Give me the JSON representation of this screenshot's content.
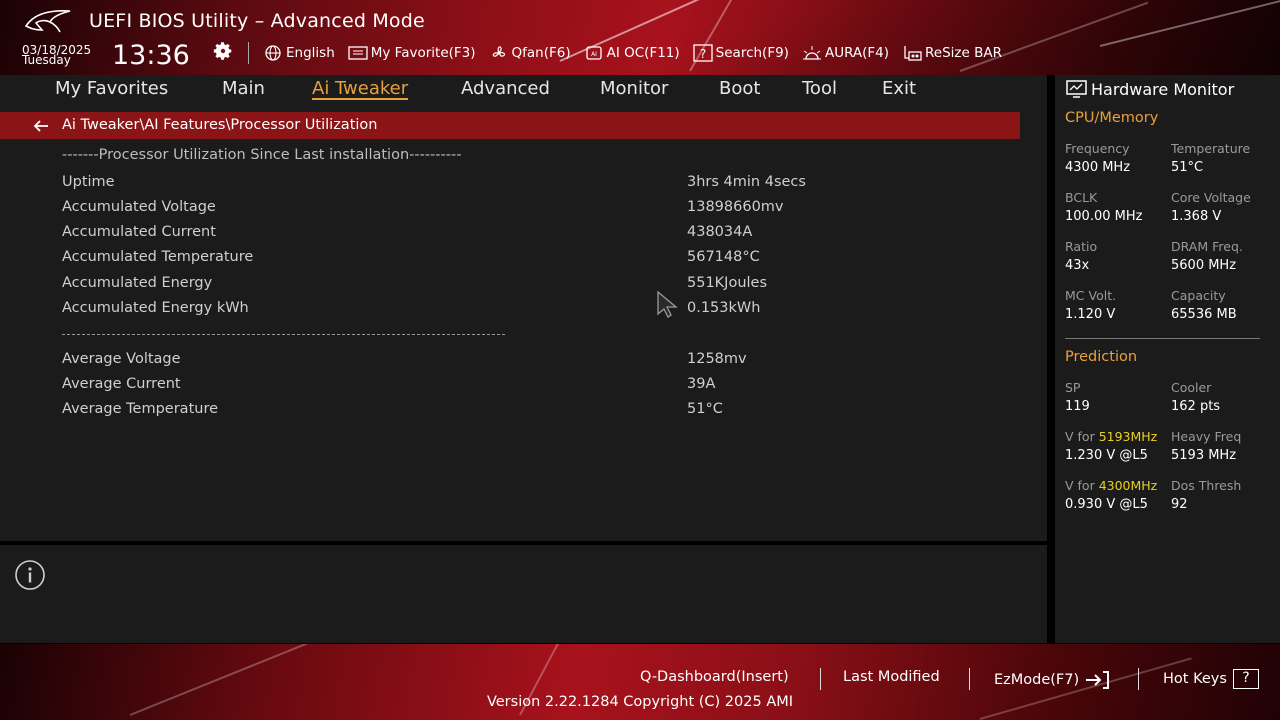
{
  "header": {
    "title": "UEFI BIOS Utility – Advanced Mode",
    "date": "03/18/2025",
    "weekday": "Tuesday",
    "time": "13:36",
    "toolbar": [
      {
        "icon": "globe-icon",
        "label": "English"
      },
      {
        "icon": "my-favorite-icon",
        "label": "My Favorite(F3)"
      },
      {
        "icon": "fan-icon",
        "label": "Qfan(F6)"
      },
      {
        "icon": "ai-oc-icon",
        "label": "AI OC(F11)"
      },
      {
        "icon": "search-icon",
        "label": "Search(F9)"
      },
      {
        "icon": "aura-icon",
        "label": "AURA(F4)"
      },
      {
        "icon": "resize-bar-icon",
        "label": "ReSize BAR"
      }
    ]
  },
  "nav": {
    "tabs": [
      {
        "label": "My Favorites",
        "active": false
      },
      {
        "label": "Main",
        "active": false
      },
      {
        "label": "Ai Tweaker",
        "active": true
      },
      {
        "label": "Advanced",
        "active": false
      },
      {
        "label": "Monitor",
        "active": false
      },
      {
        "label": "Boot",
        "active": false
      },
      {
        "label": "Tool",
        "active": false
      },
      {
        "label": "Exit",
        "active": false
      }
    ]
  },
  "breadcrumb": "Ai Tweaker\\AI Features\\Processor Utilization",
  "content": {
    "section_header": "-------Processor Utilization Since Last installation----------",
    "rows": [
      {
        "label": "Uptime",
        "value": "3hrs 4min 4secs"
      },
      {
        "label": "Accumulated Voltage",
        "value": "13898660mv"
      },
      {
        "label": "Accumulated Current",
        "value": "438034A"
      },
      {
        "label": "Accumulated Temperature",
        "value": "567148°C"
      },
      {
        "label": "Accumulated Energy",
        "value": "551KJoules"
      },
      {
        "label": "Accumulated Energy kWh",
        "value": "0.153kWh"
      }
    ],
    "average_rows": [
      {
        "label": "Average Voltage",
        "value": "1258mv"
      },
      {
        "label": "Average Current",
        "value": "39A"
      },
      {
        "label": "Average Temperature",
        "value": "51°C"
      }
    ]
  },
  "hw_monitor": {
    "title": "Hardware Monitor",
    "cpu_memory_title": "CPU/Memory",
    "cpu_memory": [
      {
        "label": "Frequency",
        "value": "4300 MHz"
      },
      {
        "label": "Temperature",
        "value": "51°C"
      },
      {
        "label": "BCLK",
        "value": "100.00 MHz"
      },
      {
        "label": "Core Voltage",
        "value": "1.368 V"
      },
      {
        "label": "Ratio",
        "value": "43x"
      },
      {
        "label": "DRAM Freq.",
        "value": "5600 MHz"
      },
      {
        "label": "MC Volt.",
        "value": "1.120 V"
      },
      {
        "label": "Capacity",
        "value": "65536 MB"
      }
    ],
    "prediction_title": "Prediction",
    "prediction": {
      "sp_label": "SP",
      "sp_value": "119",
      "cooler_label": "Cooler",
      "cooler_value": "162 pts",
      "vfor_prefix": "V for ",
      "v1_freq": "5193MHz",
      "v1_value": "1.230 V @L5",
      "heavy_label": "Heavy Freq",
      "heavy_value": "5193 MHz",
      "v2_freq": "4300MHz",
      "v2_value": "0.930 V @L5",
      "dos_label": "Dos Thresh",
      "dos_value": "92"
    }
  },
  "footer": {
    "q_dashboard": "Q-Dashboard(Insert)",
    "last_modified": "Last Modified",
    "ezmode": "EzMode(F7)",
    "hot_keys": "Hot Keys",
    "hot_keys_badge": "?",
    "version": "Version 2.22.1284 Copyright (C) 2025 AMI"
  },
  "colors": {
    "accent": "#e9a03b",
    "breadcrumb_bg": "#8a1416",
    "highlight": "#e8d021",
    "panel_bg": "#1b1b1b"
  }
}
